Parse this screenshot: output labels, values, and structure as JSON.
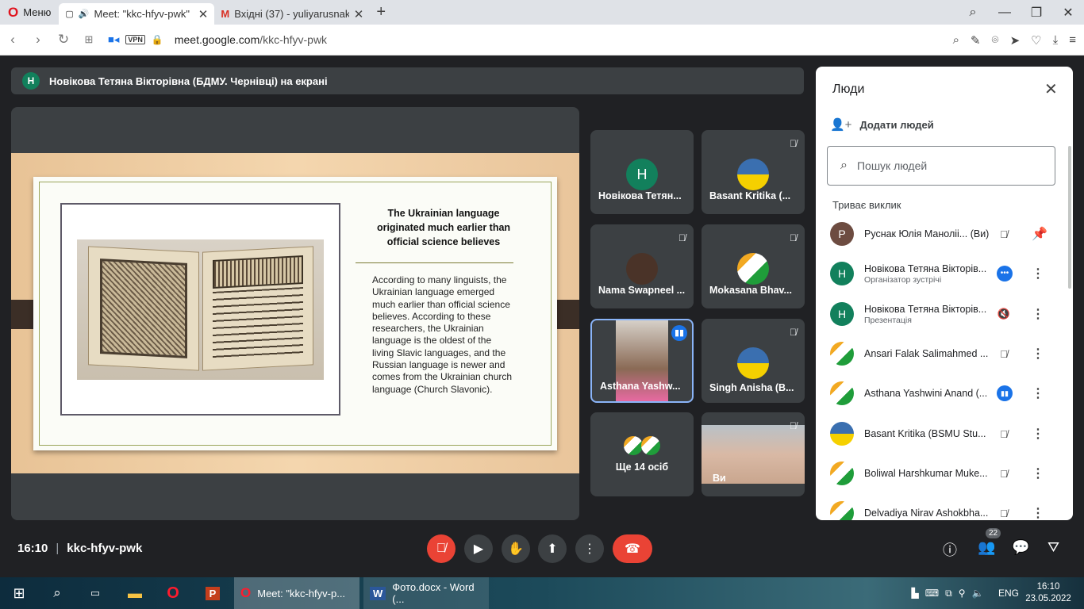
{
  "browser": {
    "menu_label": "Меню",
    "tabs": [
      {
        "title": "Meet: \"kkc-hfyv-pwk\"",
        "active": true
      },
      {
        "title": "Вхідні (37) - yuliyarusnak@",
        "active": false
      }
    ],
    "new_tab": "+",
    "vpn": "VPN",
    "url_host": "meet.google.com",
    "url_path": "/kkc-hfyv-pwk"
  },
  "meet": {
    "presenter_banner": "Новікова Тетяна Вікторівна (БДМУ. Чернівці) на екрані",
    "presenter_initial": "Н",
    "slide": {
      "title": "The Ukrainian language originated much earlier than official science believes",
      "body": "According to many linguists, the Ukrainian language emerged much earlier than official science believes. According to these researchers, the Ukrainian language is the oldest of the living Slavic languages, and the Russian language is newer and comes from the Ukrainian church language (Church Slavonic)."
    },
    "tiles": [
      {
        "name": "Новікова Тетян...",
        "initial": "Н"
      },
      {
        "name": "Basant Kritika (..."
      },
      {
        "name": "Nama Swapneel ..."
      },
      {
        "name": "Mokasana Bhav..."
      },
      {
        "name": "Asthana Yashw..."
      },
      {
        "name": "Singh Anisha (B..."
      },
      {
        "name": "Ще 14 осіб"
      },
      {
        "name": "Ви"
      }
    ],
    "time": "16:10",
    "meeting_code": "kkc-hfyv-pwk",
    "participants_count": "22"
  },
  "people": {
    "title": "Люди",
    "add_people": "Додати людей",
    "search_placeholder": "Пошук людей",
    "section": "Триває виклик",
    "list": [
      {
        "name": "Руснак Юлія Маноліі... (Ви)",
        "initial": "Р",
        "sub": ""
      },
      {
        "name": "Новікова Тетяна Вікторів...",
        "initial": "Н",
        "sub": "Організатор зустрічі"
      },
      {
        "name": "Новікова Тетяна Вікторів...",
        "initial": "Н",
        "sub": "Презентація"
      },
      {
        "name": "Ansari Falak Salimahmed ...",
        "sub": ""
      },
      {
        "name": "Asthana Yashwini Anand (...",
        "sub": ""
      },
      {
        "name": "Basant Kritika (BSMU Stu...",
        "sub": ""
      },
      {
        "name": "Boliwal Harshkumar Muke...",
        "sub": ""
      },
      {
        "name": "Delvadiya Nirav Ashokbha...",
        "sub": ""
      }
    ]
  },
  "taskbar": {
    "apps": [
      {
        "title": "Meet: \"kkc-hfyv-p..."
      },
      {
        "title": "Фото.docx - Word (..."
      }
    ],
    "lang": "ENG",
    "clock_time": "16:10",
    "clock_date": "23.05.2022"
  },
  "colors": {
    "end_call": "#ea4335",
    "accent_blue": "#1a73e8",
    "meet_bg": "#202124"
  }
}
